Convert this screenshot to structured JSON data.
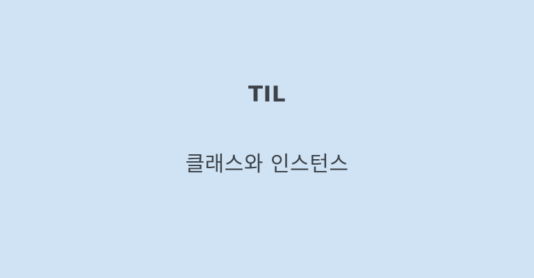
{
  "thumbnail": {
    "title": "TIL",
    "subtitle": "클래스와 인스턴스",
    "background_color": "#cfe3f4",
    "text_color": "#3d4248"
  }
}
